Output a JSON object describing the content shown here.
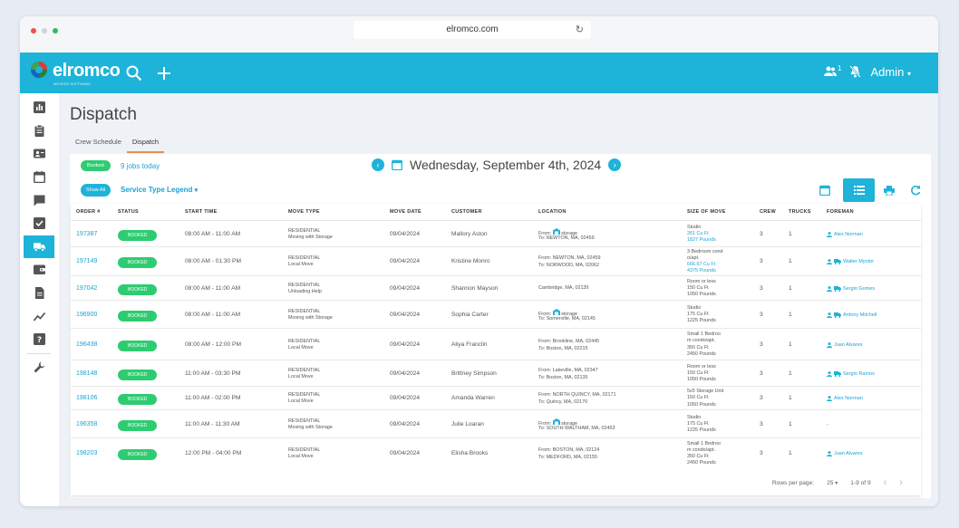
{
  "browser": {
    "url": "elromco.com"
  },
  "app": {
    "brand": "elromco",
    "tagline": "MOVERS SOFTWARE",
    "notifications_count": "1",
    "user_menu": "Admin"
  },
  "page": {
    "title": "Dispatch",
    "tabs": [
      "Crew Schedule",
      "Dispatch"
    ]
  },
  "filters": {
    "status_badge": "Booked",
    "jobs_today": "9 jobs today",
    "show_all": "Show All",
    "legend": "Service Type Legend"
  },
  "date": {
    "label": "Wednesday, September 4th, 2024"
  },
  "table": {
    "headers": [
      "ORDER #",
      "STATUS",
      "START TIME",
      "MOVE TYPE",
      "MOVE DATE",
      "CUSTOMER",
      "LOCATION",
      "SIZE OF MOVE",
      "CREW",
      "TRUCKS",
      "FOREMAN"
    ],
    "rows": [
      {
        "order": "197387",
        "status": "BOOKED",
        "start": "08:00 AM - 11:00 AM",
        "move_type": "RESIDENTIAL",
        "move_sub": "Moving with Storage",
        "date": "09/04/2024",
        "customer": "Mallory Aston",
        "from": "From:",
        "from_storage": "storage",
        "to": "To: NEWTON, MA, 02459",
        "size1": "Studio",
        "size2": "261 Cu Ft",
        "size3": "1827 Pounds",
        "size4": "",
        "crew": "3",
        "trucks": "1",
        "foreman": "Alex Norman",
        "truck_icon": false
      },
      {
        "order": "197149",
        "status": "BOOKED",
        "start": "08:00 AM - 01:30 PM",
        "move_type": "RESIDENTIAL",
        "move_sub": "Local Move",
        "date": "09/04/2024",
        "customer": "Kristine Monro",
        "from": "From: NEWTON, MA, 02459",
        "from_storage": "",
        "to": "To: NORWOOD, MA, 02062",
        "size1": "3 Bedroom cond",
        "size2": "o/apt.",
        "size3": "666.67 Cu Ft",
        "size4": "4375 Pounds",
        "crew": "3",
        "trucks": "1",
        "foreman": "Walter Myntor",
        "truck_icon": true
      },
      {
        "order": "197042",
        "status": "BOOKED",
        "start": "08:00 AM - 11:00 AM",
        "move_type": "RESIDENTIAL",
        "move_sub": "Unloading Help",
        "date": "09/04/2024",
        "customer": "Shannon Mayson",
        "from": "Cambridge, MA, 02139",
        "from_storage": "",
        "to": "",
        "size1": "Room or less",
        "size2": "150 Cu Ft",
        "size3": "1050 Pounds",
        "size4": "",
        "crew": "3",
        "trucks": "1",
        "foreman": "Sergio Gomes",
        "truck_icon": true
      },
      {
        "order": "196900",
        "status": "BOOKED",
        "start": "08:00 AM - 11:00 AM",
        "move_type": "RESIDENTIAL",
        "move_sub": "Moving with Storage",
        "date": "09/04/2024",
        "customer": "Sophia Carter",
        "from": "From:",
        "from_storage": "storage",
        "to": "To: Somerville, MA, 02145",
        "size1": "Studio",
        "size2": "175 Cu Ft",
        "size3": "1225 Pounds",
        "size4": "",
        "crew": "3",
        "trucks": "1",
        "foreman": "Antony Mitchell",
        "truck_icon": true
      },
      {
        "order": "196438",
        "status": "BOOKED",
        "start": "08:00 AM - 12:00 PM",
        "move_type": "RESIDENTIAL",
        "move_sub": "Local Move",
        "date": "09/04/2024",
        "customer": "Aliya Franclin",
        "from": "From: Brookline, MA, 02445",
        "from_storage": "",
        "to": "To: Boston, MA, 02215",
        "size1": "Small 1 Bedroo",
        "size2": "m condo/apt.",
        "size3": "350 Cu Ft",
        "size4": "2450 Pounds",
        "crew": "3",
        "trucks": "1",
        "foreman": "Juan Alvares",
        "truck_icon": false
      },
      {
        "order": "198148",
        "status": "BOOKED",
        "start": "11:00 AM - 03:30 PM",
        "move_type": "RESIDENTIAL",
        "move_sub": "Local Move",
        "date": "09/04/2024",
        "customer": "Brittney Simpson",
        "from": "From: Lakeville, MA, 02347",
        "from_storage": "",
        "to": "To: Boston, MA, 02135",
        "size1": "Room or less",
        "size2": "150 Cu Ft",
        "size3": "1050 Pounds",
        "size4": "",
        "crew": "3",
        "trucks": "1",
        "foreman": "Sergio Ramos",
        "truck_icon": true
      },
      {
        "order": "198106",
        "status": "BOOKED",
        "start": "11:00 AM - 02:00 PM",
        "move_type": "RESIDENTIAL",
        "move_sub": "Local Move",
        "date": "09/04/2024",
        "customer": "Amanda Warren",
        "from": "From: NORTH QUINCY, MA, 02171",
        "from_storage": "",
        "to": "To: Quincy, MA, 02170",
        "size1": "5x5 Storage Unit",
        "size2": "150 Cu Ft",
        "size3": "1050 Pounds",
        "size4": "",
        "crew": "3",
        "trucks": "1",
        "foreman": "Alex Norman",
        "truck_icon": false
      },
      {
        "order": "196358",
        "status": "BOOKED",
        "start": "11:00 AM - 11:30 AM",
        "move_type": "RESIDENTIAL",
        "move_sub": "Moving with Storage",
        "date": "09/04/2024",
        "customer": "Julie Loaran",
        "from": "From:",
        "from_storage": "storage",
        "to": "To: SOUTH WALTHAM, MA, 02453",
        "size1": "Studio",
        "size2": "175 Cu Ft",
        "size3": "1225 Pounds",
        "size4": "",
        "crew": "3",
        "trucks": "1",
        "foreman": "-",
        "truck_icon": false
      },
      {
        "order": "198203",
        "status": "BOOKED",
        "start": "12:00 PM - 04:00 PM",
        "move_type": "RESIDENTIAL",
        "move_sub": "Local Move",
        "date": "09/04/2024",
        "customer": "Elisha Brooks",
        "from": "From: BOSTON, MA, 02124",
        "from_storage": "",
        "to": "To: MEDFORD, MA, 02155",
        "size1": "Small 1 Bedroo",
        "size2": "m condo/apt.",
        "size3": "350 Cu Ft",
        "size4": "2450 Pounds",
        "crew": "3",
        "trucks": "1",
        "foreman": "Juan Alvares",
        "truck_icon": false
      }
    ]
  },
  "pagination": {
    "rows_per_page_label": "Rows per page:",
    "rows_per_page": "25",
    "range": "1-9 of 9"
  },
  "colors": {
    "accent": "#1eb3d9",
    "booked": "#2ecc71",
    "tab_underline": "#f08a45"
  }
}
